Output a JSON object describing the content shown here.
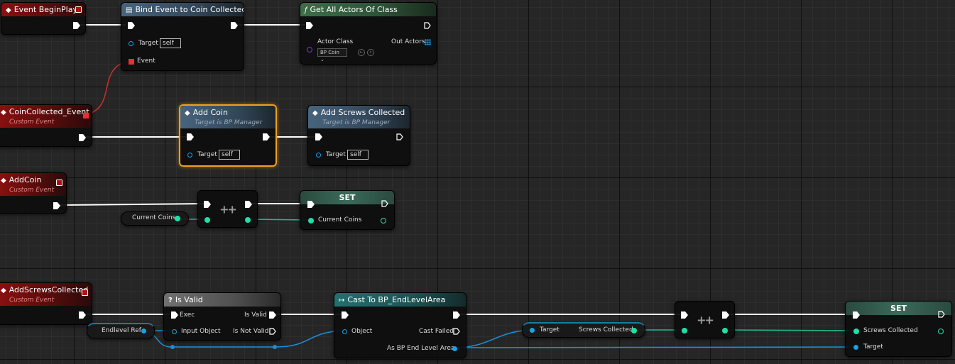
{
  "nodes": {
    "event_begin_play": {
      "title": "Event BeginPlay"
    },
    "bind_event": {
      "title": "Bind Event to Coin Collected",
      "target_label": "Target",
      "target_value": "self",
      "event_label": "Event"
    },
    "get_all_actors": {
      "title": "Get All Actors Of Class",
      "actor_class_label": "Actor Class",
      "actor_class_value": "BP Coin",
      "out_actors_label": "Out Actors"
    },
    "coin_collected_event": {
      "title": "CoinCollected_Event",
      "subtitle": "Custom Event"
    },
    "add_coin": {
      "title": "Add Coin",
      "subtitle": "Target is BP Manager",
      "target_label": "Target",
      "target_value": "self"
    },
    "add_screws_collected": {
      "title": "Add Screws Collected",
      "subtitle": "Target is BP Manager",
      "target_label": "Target",
      "target_value": "self"
    },
    "addcoin_event": {
      "title": "AddCoin",
      "subtitle": "Custom Event"
    },
    "current_coins_get": {
      "label": "Current Coins"
    },
    "increment_1": {
      "symbol": "++"
    },
    "set_coins": {
      "title": "SET",
      "var_label": "Current Coins"
    },
    "addscrews_event": {
      "title": "AddScrewsCollected",
      "subtitle": "Custom Event"
    },
    "endlevel_ref_get": {
      "label": "Endlevel Ref"
    },
    "is_valid": {
      "title": "Is Valid",
      "exec_label": "Exec",
      "input_label": "Input Object",
      "valid_label": "Is Valid",
      "not_valid_label": "Is Not Valid"
    },
    "cast_node": {
      "title": "Cast To BP_EndLevelArea",
      "object_label": "Object",
      "failed_label": "Cast Failed",
      "as_label": "As BP End Level Area"
    },
    "screws_get": {
      "target_label": "Target",
      "label": "Screws Collected"
    },
    "increment_2": {
      "symbol": "++"
    },
    "set_screws": {
      "title": "SET",
      "var_label": "Screws Collected",
      "target_label": "Target"
    }
  },
  "colors": {
    "exec": "#ffffff",
    "integer": "#1fe0a8",
    "object": "#1aa0e8",
    "delegate": "#e83030",
    "class": "#8a30e0",
    "selection": "#f0a020"
  }
}
